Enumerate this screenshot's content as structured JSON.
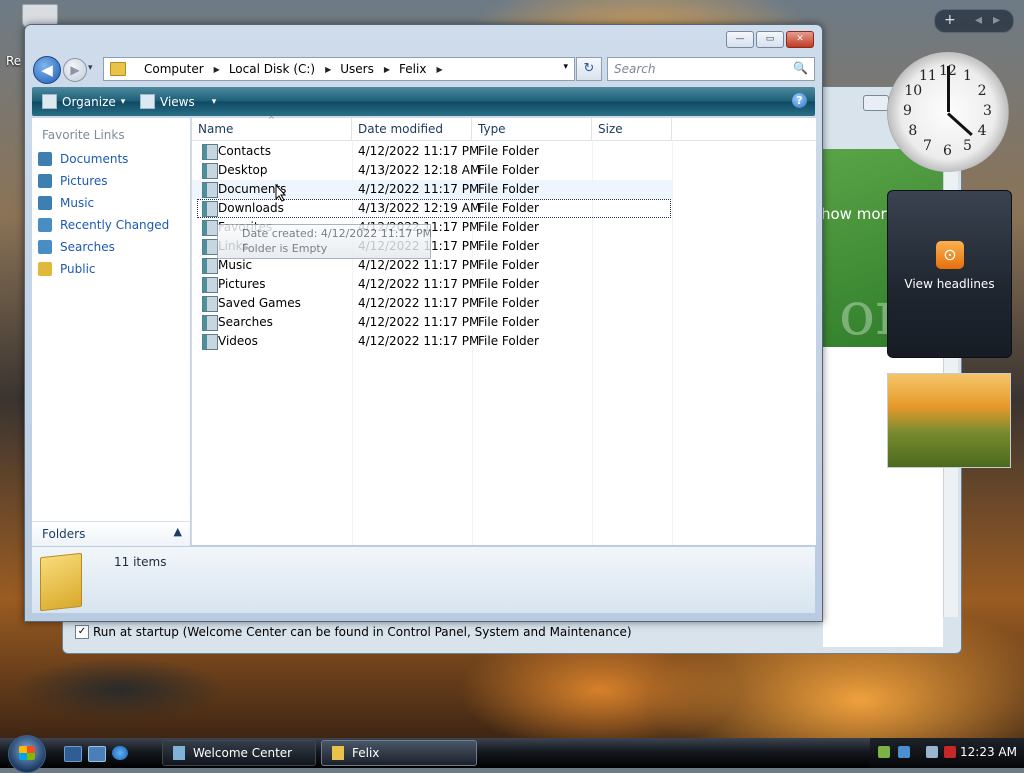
{
  "desktop": {
    "label": "Re"
  },
  "welcome_window": {
    "promo_text": "how more",
    "promo_big_text": "om",
    "startup_checkbox_checked": true,
    "startup_label": "Run at startup (Welcome Center can be found in Control Panel, System and Maintenance)"
  },
  "explorer": {
    "caption_buttons": {
      "minimize": "—",
      "maximize": "▭",
      "close": "✕"
    },
    "nav": {
      "back": "◀",
      "forward": "▶",
      "dropdown": "▾"
    },
    "address": {
      "segments": [
        "Computer",
        "Local Disk (C:)",
        "Users",
        "Felix"
      ],
      "dropdown": "▾"
    },
    "refresh_icon": "↻",
    "search": {
      "placeholder": "Search",
      "icon": "🔍"
    },
    "toolbar": {
      "organize": "Organize",
      "views": "Views",
      "help": "?",
      "dropdown": "▾"
    },
    "nav_pane": {
      "title": "Favorite Links",
      "links": [
        {
          "label": "Documents",
          "icon": "documents-icon",
          "color": "#3c7fb0"
        },
        {
          "label": "Pictures",
          "icon": "pictures-icon",
          "color": "#3c7fb0"
        },
        {
          "label": "Music",
          "icon": "music-icon",
          "color": "#3c7fb0"
        },
        {
          "label": "Recently Changed",
          "icon": "recently-changed-icon",
          "color": "#4a8cc4"
        },
        {
          "label": "Searches",
          "icon": "searches-icon",
          "color": "#4a8cc4"
        },
        {
          "label": "Public",
          "icon": "public-folder-icon",
          "color": "#e0b93a"
        }
      ],
      "folders_label": "Folders",
      "folders_chevron": "▲"
    },
    "columns": [
      "Name",
      "Date modified",
      "Type",
      "Size"
    ],
    "sort_indicator": "^",
    "files": [
      {
        "name": "Contacts",
        "modified": "4/12/2022 11:17 PM",
        "type": "File Folder",
        "size": ""
      },
      {
        "name": "Desktop",
        "modified": "4/13/2022 12:18 AM",
        "type": "File Folder",
        "size": ""
      },
      {
        "name": "Documents",
        "modified": "4/12/2022 11:17 PM",
        "type": "File Folder",
        "size": ""
      },
      {
        "name": "Downloads",
        "modified": "4/13/2022 12:19 AM",
        "type": "File Folder",
        "size": ""
      },
      {
        "name": "Favorites",
        "modified": "4/12/2022 11:17 PM",
        "type": "File Folder",
        "size": ""
      },
      {
        "name": "Links",
        "modified": "4/12/2022 11:17 PM",
        "type": "File Folder",
        "size": ""
      },
      {
        "name": "Music",
        "modified": "4/12/2022 11:17 PM",
        "type": "File Folder",
        "size": ""
      },
      {
        "name": "Pictures",
        "modified": "4/12/2022 11:17 PM",
        "type": "File Folder",
        "size": ""
      },
      {
        "name": "Saved Games",
        "modified": "4/12/2022 11:17 PM",
        "type": "File Folder",
        "size": ""
      },
      {
        "name": "Searches",
        "modified": "4/12/2022 11:17 PM",
        "type": "File Folder",
        "size": ""
      },
      {
        "name": "Videos",
        "modified": "4/12/2022 11:17 PM",
        "type": "File Folder",
        "size": ""
      }
    ],
    "tooltip": {
      "line1": "Date created: 4/12/2022 11:17 PM",
      "line2": "Folder is Empty"
    },
    "details": {
      "item_count": "11 items"
    }
  },
  "sidebar": {
    "top_controls": {
      "add": "+",
      "prev": "◂",
      "next": "▸"
    },
    "clock_numbers": [
      "12",
      "1",
      "2",
      "3",
      "4",
      "5",
      "6",
      "7",
      "8",
      "9",
      "10",
      "11"
    ],
    "feed_label": "View headlines"
  },
  "taskbar": {
    "buttons": [
      {
        "label": "Welcome Center",
        "active": false
      },
      {
        "label": "Felix",
        "active": true
      }
    ],
    "time": "12:23 AM"
  }
}
